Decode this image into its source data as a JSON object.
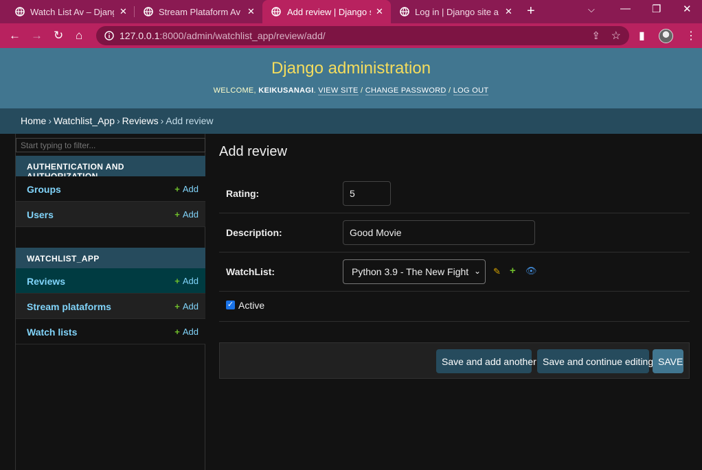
{
  "browser": {
    "tabs": [
      {
        "title": "Watch List Av – Django"
      },
      {
        "title": "Stream Plataform Av – I"
      },
      {
        "title": "Add review | Django site"
      },
      {
        "title": "Log in | Django site adm"
      }
    ],
    "url_host": "127.0.0.1",
    "url_path": ":8000/admin/watchlist_app/review/add/"
  },
  "header": {
    "site_title": "Django administration",
    "welcome": "Welcome,",
    "username": "keikusanagi",
    "view_site": "View site",
    "change_password": "Change password",
    "log_out": "Log out"
  },
  "breadcrumbs": {
    "home": "Home",
    "app": "Watchlist_App",
    "model": "Reviews",
    "current": "Add review"
  },
  "sidebar": {
    "filter_placeholder": "Start typing to filter...",
    "modules": [
      {
        "caption": "Authentication and Authorization",
        "items": [
          {
            "name": "Groups",
            "add": "Add"
          },
          {
            "name": "Users",
            "add": "Add"
          }
        ]
      },
      {
        "caption": "Watchlist_App",
        "items": [
          {
            "name": "Reviews",
            "add": "Add"
          },
          {
            "name": "Stream plataforms",
            "add": "Add"
          },
          {
            "name": "Watch lists",
            "add": "Add"
          }
        ]
      }
    ]
  },
  "content": {
    "title": "Add review",
    "fields": {
      "rating": {
        "label": "Rating:",
        "value": "5"
      },
      "description": {
        "label": "Description:",
        "value": "Good Movie"
      },
      "watchlist": {
        "label": "WatchList:",
        "value": "Python 3.9 - The New Fight"
      },
      "active": {
        "label": "Active",
        "checked": true
      }
    },
    "buttons": {
      "save_add_another": "Save and add another",
      "save_continue": "Save and continue editing",
      "save": "SAVE"
    }
  },
  "colors": {
    "header_bg": "#417690",
    "breadcrumb_bg": "#264b5d",
    "link": "#81d4fa",
    "accent_yellow": "#f5dd5d",
    "browser_frame": "#b8225f"
  }
}
